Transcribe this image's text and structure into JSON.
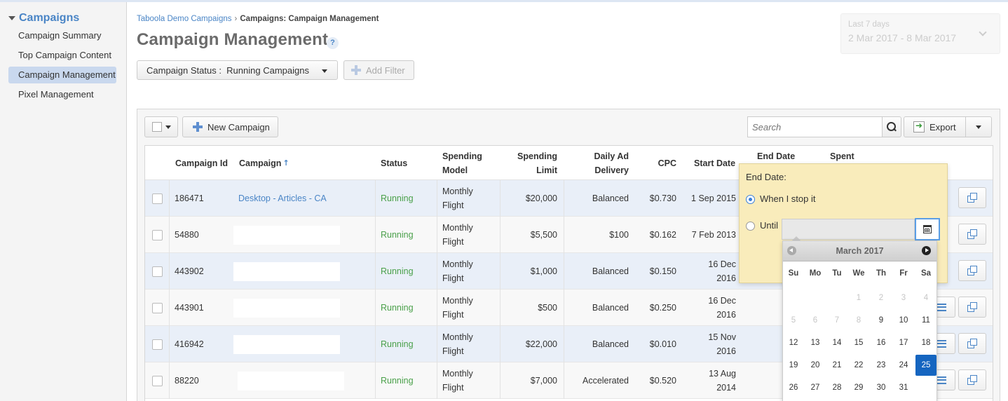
{
  "sidebar": {
    "heading": "Campaigns",
    "items": [
      {
        "label": "Campaign Summary",
        "active": false
      },
      {
        "label": "Top Campaign Content",
        "active": false
      },
      {
        "label": "Campaign Management",
        "active": true
      },
      {
        "label": "Pixel Management",
        "active": false
      }
    ]
  },
  "header": {
    "breadcrumb_root": "Taboola Demo Campaigns",
    "breadcrumb_current": "Campaigns: Campaign Management",
    "title": "Campaign Management",
    "help_label": "?",
    "date_range_label": "Last 7 days",
    "date_range_value": "2 Mar 2017 - 8 Mar 2017"
  },
  "filters": {
    "status_label": "Campaign Status :  Running Campaigns",
    "add_filter_label": "Add Filter"
  },
  "toolbar": {
    "new_campaign_label": "New Campaign",
    "search_placeholder": "Search",
    "export_label": "Export"
  },
  "table": {
    "columns": {
      "campaign_id": "Campaign Id",
      "campaign": "Campaign",
      "status": "Status",
      "spending_model": "Spending Model",
      "spending_limit": "Spending Limit",
      "daily_ad_delivery": "Daily Ad Delivery",
      "cpc": "CPC",
      "start_date": "Start Date",
      "end_date": "End Date",
      "spent": "Spent"
    },
    "rows": [
      {
        "id": "186471",
        "name": "Desktop - Articles - CA",
        "status": "Running",
        "model": "Monthly Flight",
        "limit": "$20,000",
        "delivery": "Balanced",
        "cpc": "$0.730",
        "start": "1 Sep 2015"
      },
      {
        "id": "54880",
        "name": "",
        "status": "Running",
        "model": "Monthly Flight",
        "limit": "$5,500",
        "delivery": "$100",
        "cpc": "$0.162",
        "start": "7 Feb 2013"
      },
      {
        "id": "443902",
        "name": "",
        "status": "Running",
        "model": "Monthly Flight",
        "limit": "$1,000",
        "delivery": "Balanced",
        "cpc": "$0.150",
        "start": "16 Dec 2016"
      },
      {
        "id": "443901",
        "name": "",
        "status": "Running",
        "model": "Monthly Flight",
        "limit": "$500",
        "delivery": "Balanced",
        "cpc": "$0.250",
        "start": "16 Dec 2016"
      },
      {
        "id": "416942",
        "name": "",
        "status": "Running",
        "model": "Monthly Flight",
        "limit": "$22,000",
        "delivery": "Balanced",
        "cpc": "$0.010",
        "start": "15 Nov 2016"
      },
      {
        "id": "88220",
        "name": "",
        "status": "Running",
        "model": "Monthly Flight",
        "limit": "$7,000",
        "delivery": "Accelerated",
        "cpc": "$0.520",
        "start": "13 Aug 2014"
      }
    ]
  },
  "end_date_popover": {
    "title": "End Date:",
    "option_stop": "When I stop it",
    "option_until": "Until",
    "selected_option": "When I stop it"
  },
  "calendar": {
    "month": "March 2017",
    "weekdays": [
      "Su",
      "Mo",
      "Tu",
      "We",
      "Th",
      "Fr",
      "Sa"
    ],
    "weeks": [
      [
        "",
        "",
        "",
        "1",
        "2",
        "3",
        "4"
      ],
      [
        "5",
        "6",
        "7",
        "8",
        "9",
        "10",
        "11"
      ],
      [
        "12",
        "13",
        "14",
        "15",
        "16",
        "17",
        "18"
      ],
      [
        "19",
        "20",
        "21",
        "22",
        "23",
        "24",
        "25"
      ],
      [
        "26",
        "27",
        "28",
        "29",
        "30",
        "31",
        ""
      ]
    ],
    "selected_day": "25",
    "disabled_through_day": 8
  },
  "colors": {
    "accent": "#4a85c6",
    "running": "#4aa04a",
    "selected_day": "#1565c0",
    "popover_bg": "#f9ecbb"
  }
}
